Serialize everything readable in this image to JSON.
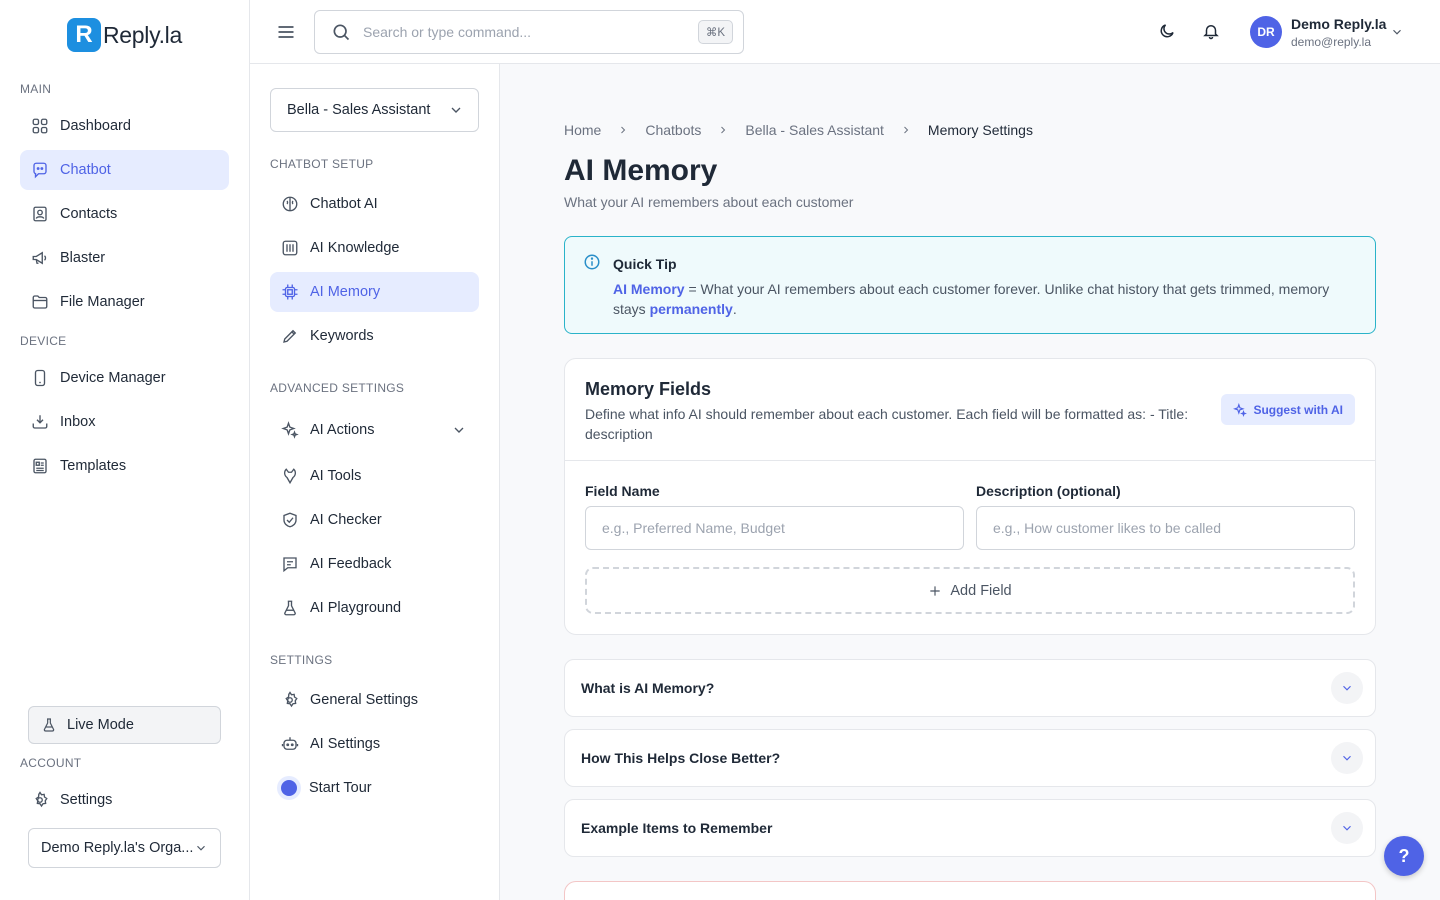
{
  "app": {
    "logo_mark": "R",
    "logo_text": "Reply.la"
  },
  "colors": {
    "accent": "#4f63e6",
    "tip_border": "#2ab3c9",
    "active_bg": "#e6ecff"
  },
  "sidebar": {
    "main_label": "MAIN",
    "main_items": [
      {
        "label": "Dashboard",
        "icon": "grid-icon"
      },
      {
        "label": "Chatbot",
        "icon": "chat-bot-icon",
        "active": true
      },
      {
        "label": "Contacts",
        "icon": "contacts-icon"
      },
      {
        "label": "Blaster",
        "icon": "megaphone-icon"
      },
      {
        "label": "File Manager",
        "icon": "folder-icon"
      }
    ],
    "device_label": "DEVICE",
    "device_items": [
      {
        "label": "Device Manager",
        "icon": "phone-icon"
      },
      {
        "label": "Inbox",
        "icon": "inbox-download-icon"
      },
      {
        "label": "Templates",
        "icon": "templates-icon"
      }
    ],
    "live_mode": "Live Mode",
    "account_label": "ACCOUNT",
    "settings": "Settings",
    "org": "Demo Reply.la's Orga..."
  },
  "header": {
    "search_placeholder": "Search or type command...",
    "shortcut": "⌘K",
    "user_initials": "DR",
    "user_name": "Demo Reply.la",
    "user_email": "demo@reply.la"
  },
  "sub_sidebar": {
    "bot_select": "Bella - Sales Assistant",
    "setup_label": "CHATBOT SETUP",
    "setup_items": [
      {
        "label": "Chatbot AI",
        "icon": "brain-icon"
      },
      {
        "label": "AI Knowledge",
        "icon": "book-icon"
      },
      {
        "label": "AI Memory",
        "icon": "chip-icon",
        "active": true
      },
      {
        "label": "Keywords",
        "icon": "pen-icon"
      }
    ],
    "advanced_label": "ADVANCED SETTINGS",
    "advanced_items": [
      {
        "label": "AI Actions",
        "icon": "sparkles-icon"
      },
      {
        "label": "AI Tools",
        "icon": "tools-icon"
      },
      {
        "label": "AI Checker",
        "icon": "shield-check-icon"
      },
      {
        "label": "AI Feedback",
        "icon": "feedback-icon"
      },
      {
        "label": "AI Playground",
        "icon": "flask-icon"
      }
    ],
    "settings_label": "SETTINGS",
    "settings_items": [
      {
        "label": "General Settings",
        "icon": "gear-icon"
      },
      {
        "label": "AI Settings",
        "icon": "robot-icon"
      },
      {
        "label": "Start Tour",
        "icon": "tour-icon"
      }
    ]
  },
  "main": {
    "breadcrumbs": [
      "Home",
      "Chatbots",
      "Bella - Sales Assistant",
      "Memory Settings"
    ],
    "title": "AI Memory",
    "subtitle": "What your AI remembers about each customer",
    "tip": {
      "title": "Quick Tip",
      "term": "AI Memory",
      "body": " = What your AI remembers about each customer forever. Unlike chat history that gets trimmed, memory stays ",
      "highlight": "permanently",
      "end": "."
    },
    "memory": {
      "title": "Memory Fields",
      "description": "Define what info AI should remember about each customer. Each field will be formatted as: - Title: description",
      "suggest": "Suggest with AI",
      "field_name_label": "Field Name",
      "field_name_placeholder": "e.g., Preferred Name, Budget",
      "description_label": "Description (optional)",
      "description_placeholder": "e.g., How customer likes to be called",
      "add_field": "Add Field"
    },
    "faqs": [
      "What is AI Memory?",
      "How This Helps Close Better?",
      "Example Items to Remember"
    ]
  },
  "help_button": "?"
}
